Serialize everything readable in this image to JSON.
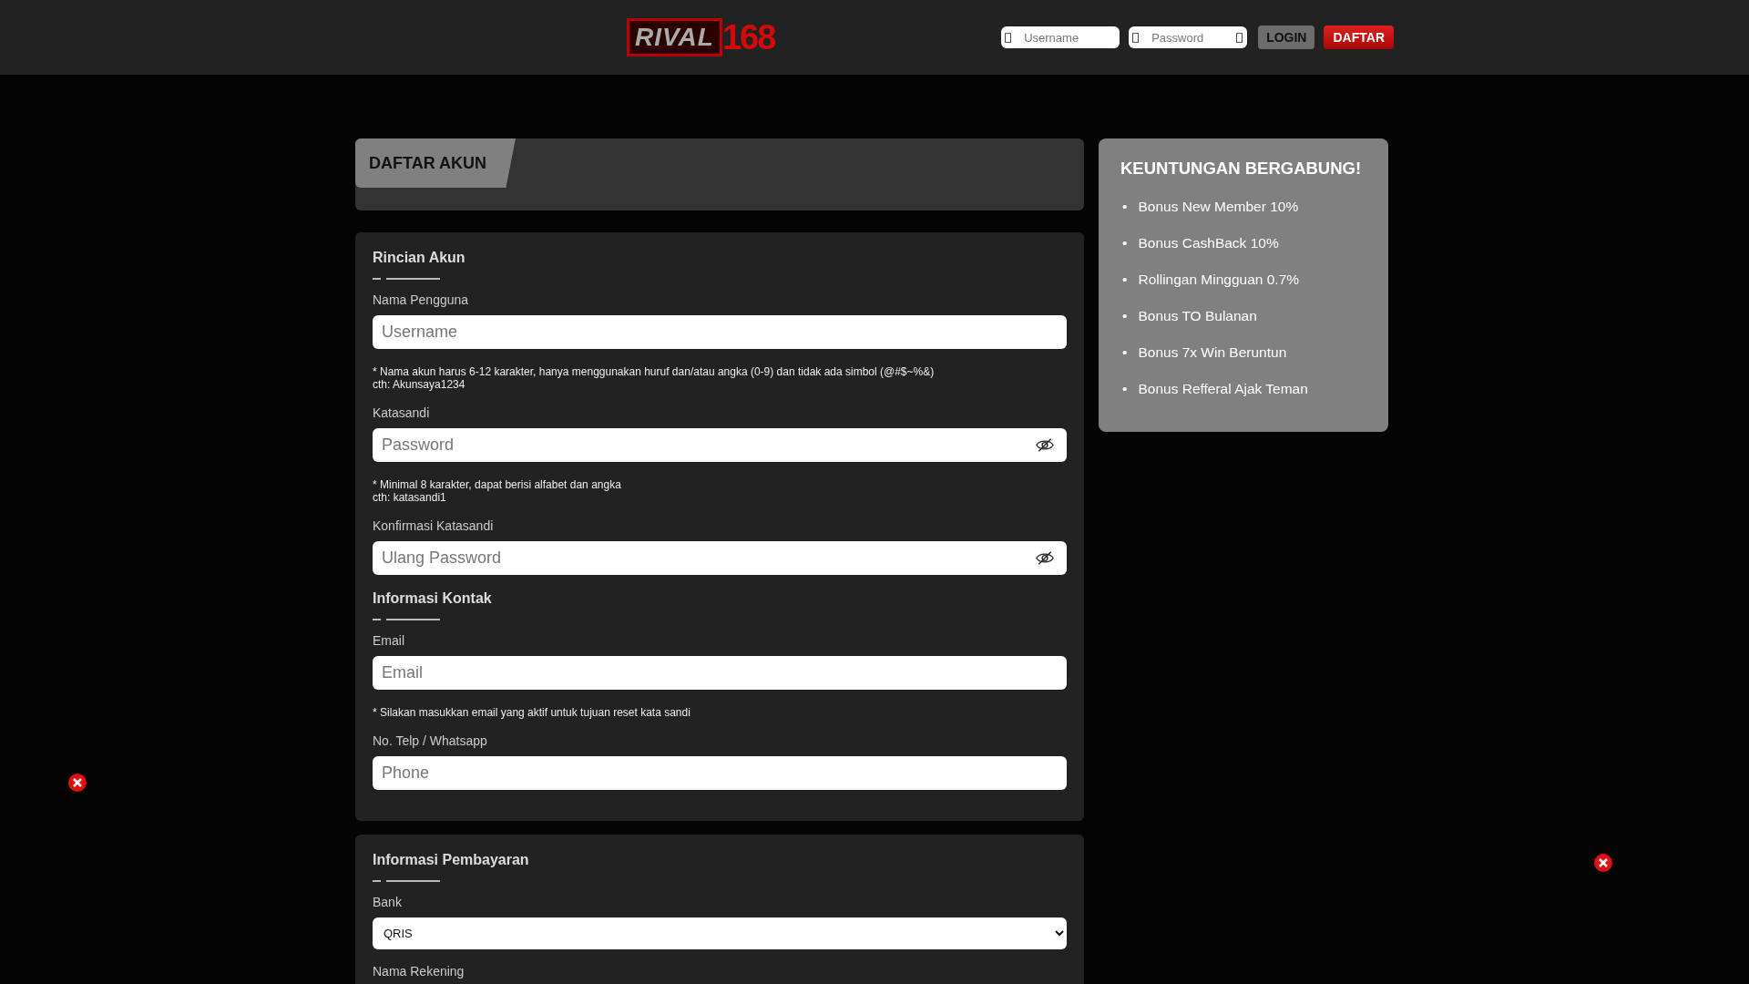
{
  "header": {
    "logo": {
      "word": "RIVAL",
      "number": "168"
    },
    "username": {
      "placeholder": "Username"
    },
    "password": {
      "placeholder": "Password"
    },
    "buttons": [
      {
        "kind": "login",
        "label": "LOGIN"
      },
      {
        "kind": "register",
        "label": "DAFTAR"
      }
    ]
  },
  "page_title": "DAFTAR AKUN",
  "cards": [
    {
      "sections": [
        {
          "title": "Rincian Akun",
          "fields": [
            {
              "label": "Nama Pengguna",
              "kind": "text",
              "placeholder": "Username",
              "hint": [
                "* Nama akun harus 6-12 karakter, hanya menggunakan huruf dan/atau angka (0-9) dan tidak ada simbol (@#$~%&)",
                "cth: Akunsaya1234"
              ]
            },
            {
              "label": "Katasandi",
              "kind": "password",
              "placeholder": "Password",
              "hint": [
                "* Minimal 8 karakter, dapat berisi alfabet dan angka",
                "cth: katasandi1"
              ]
            },
            {
              "label": "Konfirmasi Katasandi",
              "kind": "password",
              "placeholder": "Ulang Password"
            }
          ]
        },
        {
          "title": "Informasi Kontak",
          "fields": [
            {
              "label": "Email",
              "kind": "text",
              "placeholder": "Email",
              "hint": [
                "* Silakan masukkan email yang aktif untuk tujuan reset kata sandi"
              ]
            },
            {
              "label": "No. Telp / Whatsapp",
              "kind": "text",
              "placeholder": "Phone"
            }
          ]
        }
      ]
    },
    {
      "sections": [
        {
          "title": "Informasi Pembayaran",
          "fields": [
            {
              "label": "Bank",
              "kind": "select",
              "value": "QRIS"
            },
            {
              "label": "Nama Rekening",
              "kind": "label-only"
            }
          ]
        }
      ]
    }
  ],
  "benefits": {
    "title": "KEUNTUNGAN BERGABUNG!",
    "bullet": "•",
    "items": [
      "Bonus New Member 10%",
      "Bonus CashBack 10%",
      "Rollingan Mingguan 0.7%",
      "Bonus TO Bulanan",
      "Bonus 7x Win Beruntun",
      "Bonus Refferal Ajak Teman"
    ]
  }
}
